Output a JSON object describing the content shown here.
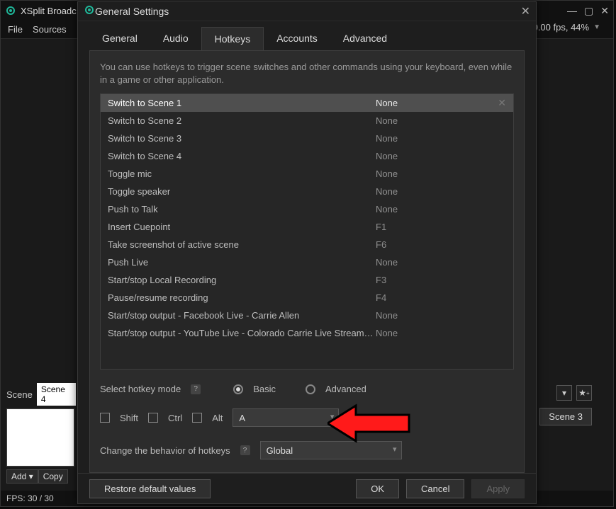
{
  "main": {
    "title": "XSplit Broadc",
    "menubar": [
      "File",
      "Sources"
    ],
    "topstatus": "0.00 fps, 44%",
    "fps_label": "FPS:",
    "fps_value": "30 / 30",
    "scene_label": "Scene",
    "scene_tab": "Scene 4",
    "add_btn": "Add",
    "copy_btn": "Copy",
    "scene3_btn": "Scene 3"
  },
  "dialog": {
    "title": "General Settings",
    "tabs": [
      "General",
      "Audio",
      "Hotkeys",
      "Accounts",
      "Advanced"
    ],
    "active_tab": 2,
    "desc": "You can use hotkeys to trigger scene switches and other commands using your keyboard, even while in a game or other application.",
    "hotkeys": [
      {
        "name": "Switch to Scene 1",
        "value": "None",
        "selected": true
      },
      {
        "name": "Switch to Scene 2",
        "value": "None"
      },
      {
        "name": "Switch to Scene 3",
        "value": "None"
      },
      {
        "name": "Switch to Scene 4",
        "value": "None"
      },
      {
        "name": "Toggle mic",
        "value": "None"
      },
      {
        "name": "Toggle speaker",
        "value": "None"
      },
      {
        "name": "Push to Talk",
        "value": "None"
      },
      {
        "name": "Insert Cuepoint",
        "value": "F1"
      },
      {
        "name": "Take screenshot of active scene",
        "value": "F6"
      },
      {
        "name": "Push Live",
        "value": "None"
      },
      {
        "name": "Start/stop Local Recording",
        "value": "F3"
      },
      {
        "name": "Pause/resume recording",
        "value": "F4"
      },
      {
        "name": "Start/stop output - Facebook Live - Carrie Allen",
        "value": "None"
      },
      {
        "name": "Start/stop output - YouTube Live - Colorado Carrie Live Stream - P...",
        "value": "None"
      }
    ],
    "select_mode_label": "Select hotkey mode",
    "mode_basic": "Basic",
    "mode_advanced": "Advanced",
    "shift": "Shift",
    "ctrl": "Ctrl",
    "alt": "Alt",
    "key_value": "A",
    "behavior_label": "Change the behavior of hotkeys",
    "behavior_value": "Global",
    "restore": "Restore default values",
    "ok": "OK",
    "cancel": "Cancel",
    "apply": "Apply"
  }
}
